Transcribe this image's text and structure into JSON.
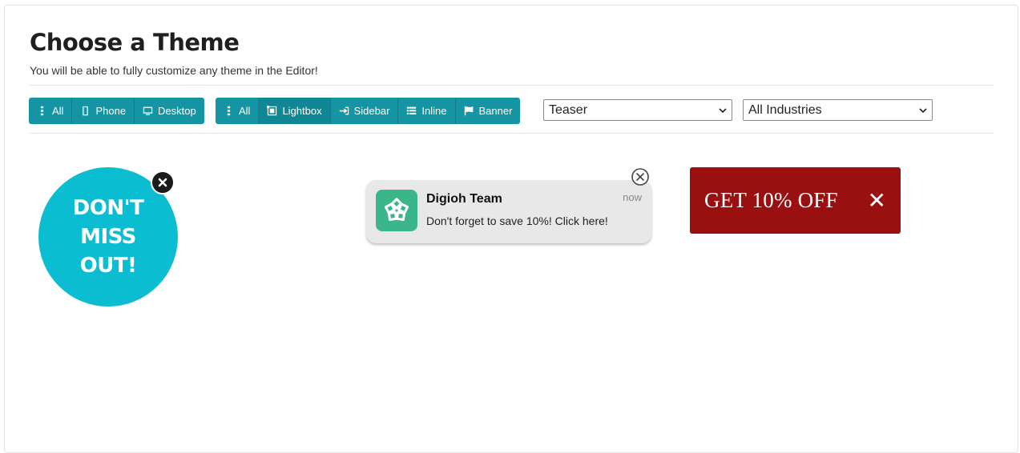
{
  "header": {
    "title": "Choose a Theme",
    "subtitle": "You will be able to fully customize any theme in the Editor!"
  },
  "device_filter": {
    "items": [
      {
        "label": "All",
        "icon": "kebab-icon",
        "active": true
      },
      {
        "label": "Phone",
        "icon": "phone-icon",
        "active": false
      },
      {
        "label": "Desktop",
        "icon": "monitor-icon",
        "active": false
      }
    ]
  },
  "type_filter": {
    "items": [
      {
        "label": "All",
        "icon": "kebab-icon",
        "active": false
      },
      {
        "label": "Lightbox",
        "icon": "lightbox-icon",
        "active": true
      },
      {
        "label": "Sidebar",
        "icon": "sign-in-icon",
        "active": false
      },
      {
        "label": "Inline",
        "icon": "list-icon",
        "active": false
      },
      {
        "label": "Banner",
        "icon": "flag-icon",
        "active": false
      }
    ]
  },
  "selects": {
    "style": "Teaser",
    "industry": "All Industries"
  },
  "themes": {
    "circle": {
      "line1": "DON'T",
      "line2": "MISS",
      "line3": "OUT!"
    },
    "notification": {
      "title": "Digioh Team",
      "time": "now",
      "message": "Don't forget to save 10%! Click here!"
    },
    "banner": {
      "text": "GET 10% OFF",
      "close": "✕"
    }
  },
  "colors": {
    "button": "#1595a3",
    "circle": "#0bbdd0",
    "banner": "#9a1010",
    "notif_logo": "#3bb58a"
  }
}
